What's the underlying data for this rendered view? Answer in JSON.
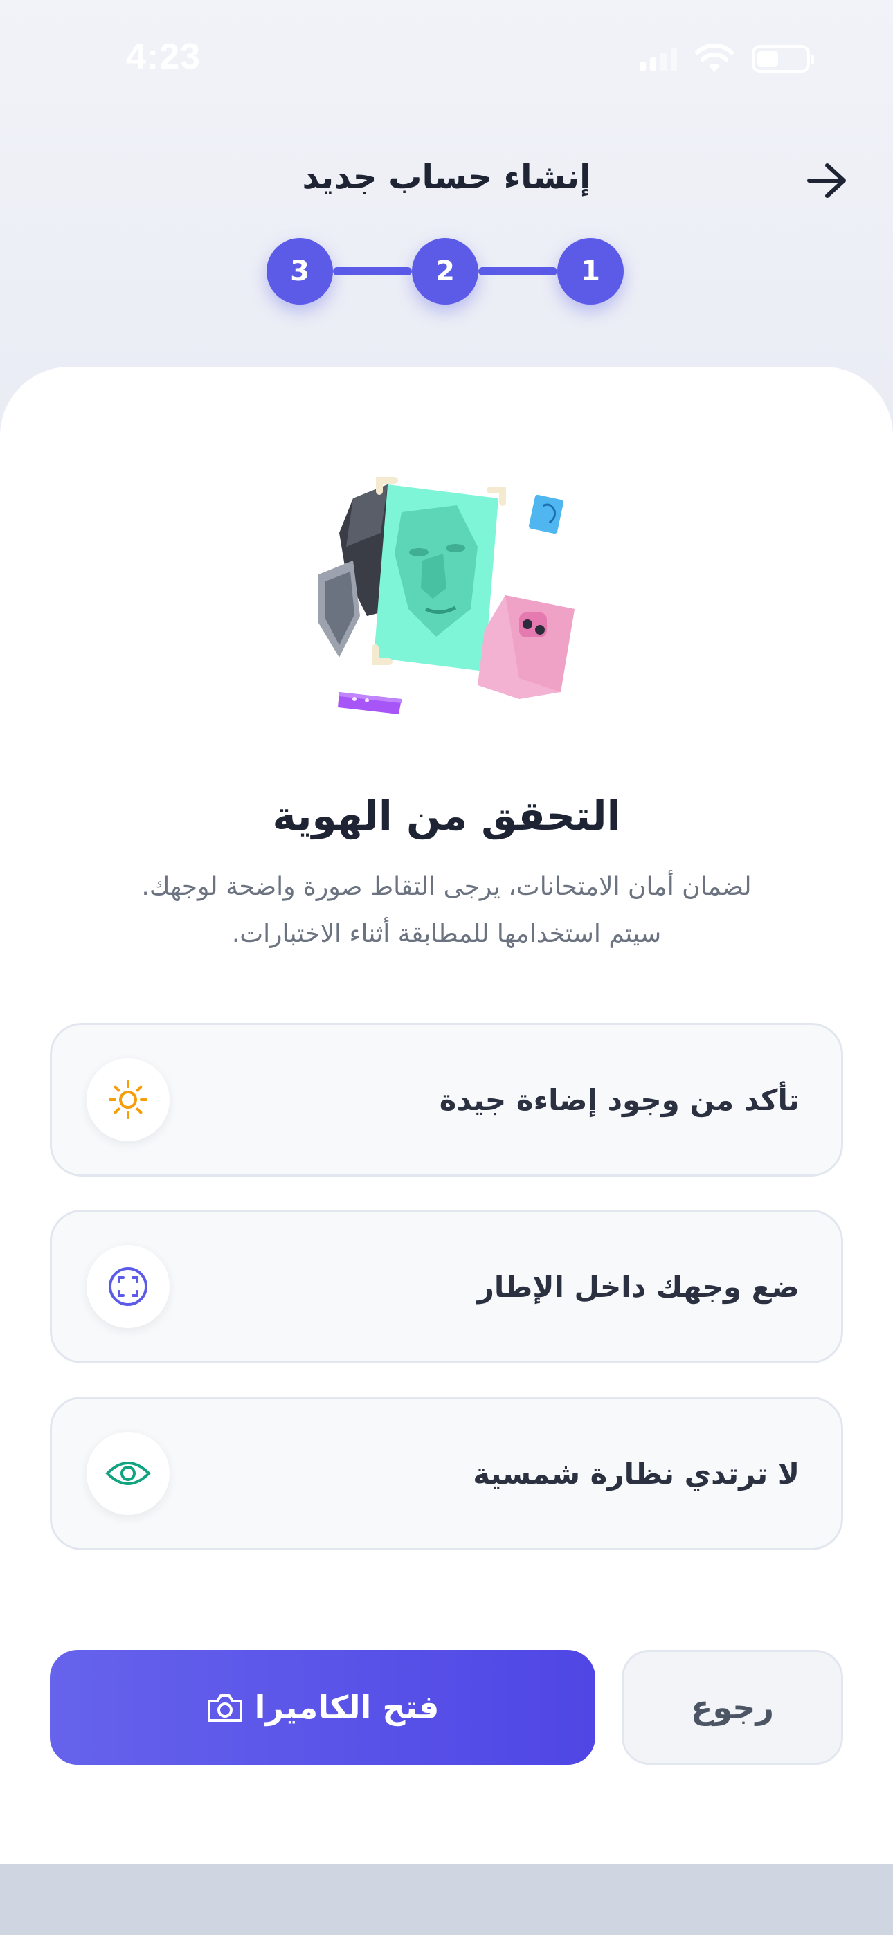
{
  "status_bar": {
    "time": "4:23"
  },
  "header": {
    "title": "إنشاء حساب جديد",
    "steps": [
      "1",
      "2",
      "3"
    ]
  },
  "verification": {
    "title": "التحقق من الهوية",
    "description": "لضمان أمان الامتحانات، يرجى التقاط صورة واضحة لوجهك. سيتم استخدامها للمطابقة أثناء الاختبارات."
  },
  "tips": [
    {
      "label": "تأكد من وجود إضاءة جيدة",
      "icon": "sun-icon",
      "color": "#f59e0b"
    },
    {
      "label": "ضع وجهك داخل الإطار",
      "icon": "face-frame-icon",
      "color": "#5b5be8"
    },
    {
      "label": "لا ترتدي نظارة شمسية",
      "icon": "eye-icon",
      "color": "#10a37f"
    }
  ],
  "actions": {
    "open_camera": "فتح الكاميرا",
    "back": "رجوع"
  },
  "colors": {
    "accent": "#5b5be8",
    "title": "#1e2433",
    "muted": "#6b7280"
  }
}
